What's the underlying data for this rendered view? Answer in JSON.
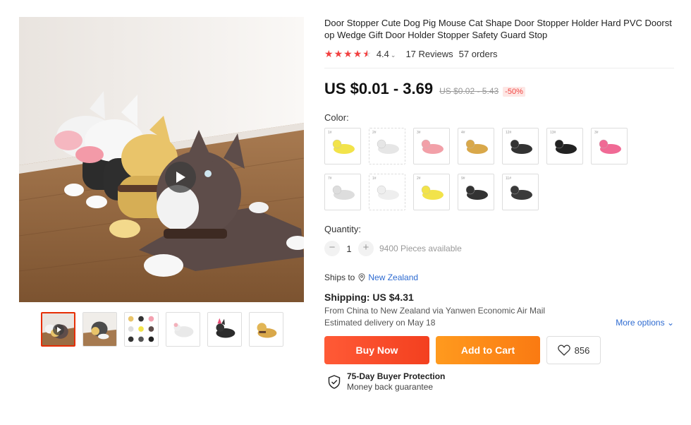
{
  "product": {
    "title": "Door Stopper Cute Dog Pig Mouse Cat Shape Door Stopper Holder Hard PVC Doorstop Wedge Gift Door Holder Stopper Safety Guard Stop",
    "rating": "4.4",
    "rating_stars": 4.5,
    "reviews": "17 Reviews",
    "orders": "57 orders",
    "price": "US $0.01 - 3.69",
    "old_price": "US $0.02 - 5.43",
    "discount": "-50%"
  },
  "gallery": {
    "play_icon": "play-icon",
    "thumbnails": [
      {
        "name": "thumb-video",
        "active": true
      },
      {
        "name": "thumb-dog-gray"
      },
      {
        "name": "thumb-variants-grid"
      },
      {
        "name": "thumb-mouse-white"
      },
      {
        "name": "thumb-cat-black"
      },
      {
        "name": "thumb-dog-yellow"
      }
    ]
  },
  "color": {
    "label": "Color:",
    "options": [
      {
        "name": "rabbit-yellow",
        "color": "#f2e34a",
        "tag": "1#"
      },
      {
        "name": "mouse-white",
        "color": "#e6e6e6",
        "tag": "2#",
        "dashed": true
      },
      {
        "name": "pig-pink",
        "color": "#f2a0a8",
        "tag": "3#"
      },
      {
        "name": "dog-yellow",
        "color": "#d9a84a",
        "tag": "4#"
      },
      {
        "name": "bullterrier-black",
        "color": "#333333",
        "tag": "12#"
      },
      {
        "name": "cat-black",
        "color": "#222222",
        "tag": "13#"
      },
      {
        "name": "cat-pink",
        "color": "#f06a95",
        "tag": "3#"
      },
      {
        "name": "dog-white",
        "color": "#dddddd",
        "tag": "7#"
      },
      {
        "name": "mouse-white-2",
        "color": "#eeeeee",
        "tag": "1#",
        "dashed": true
      },
      {
        "name": "rabbit-yellow-2",
        "color": "#f2e34a",
        "tag": "2#"
      },
      {
        "name": "pig-black",
        "color": "#333333",
        "tag": "9#"
      },
      {
        "name": "dog-black",
        "color": "#3a3a3a",
        "tag": "11#"
      }
    ]
  },
  "quantity": {
    "label": "Quantity:",
    "value": "1",
    "minus": "−",
    "plus": "+",
    "available": "9400 Pieces available"
  },
  "shipping": {
    "ships_to_label": "Ships to",
    "country": "New Zealand",
    "title": "Shipping: US $4.31",
    "from_text": "From China to New Zealand via Yanwen Economic Air Mail",
    "delivery": "Estimated delivery on May 18",
    "more_options": "More options"
  },
  "actions": {
    "buy_now": "Buy Now",
    "add_to_cart": "Add to Cart",
    "wishlist_count": "856"
  },
  "protection": {
    "title": "75-Day Buyer Protection",
    "subtitle": "Money back guarantee"
  },
  "colors": {
    "accent_red": "#f2433f",
    "buy_orange": "#f3401f",
    "cart_orange": "#fa7a12",
    "link_blue": "#2e6bd1",
    "star_red": "#f24141"
  }
}
